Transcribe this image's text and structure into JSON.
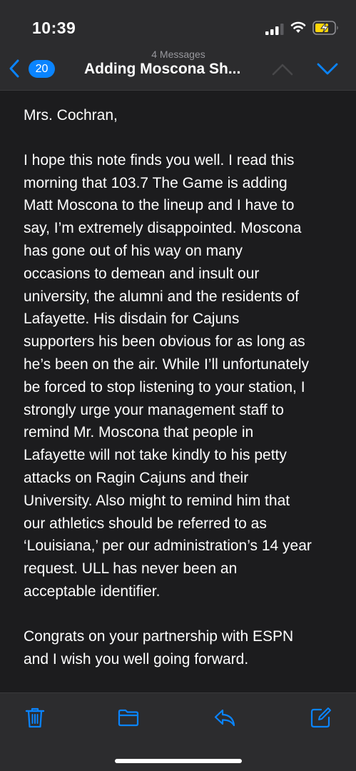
{
  "status_bar": {
    "time": "10:39",
    "icons": [
      "signal-icon",
      "wifi-icon",
      "battery-charging-icon"
    ]
  },
  "nav": {
    "back_count": "20",
    "subtitle": "4 Messages",
    "title": "Adding Moscona Sh...",
    "accent_color": "#0a84ff",
    "icons": [
      "chevron-left-icon",
      "chevron-up-icon",
      "chevron-down-icon"
    ]
  },
  "message": {
    "greeting": "Mrs. Cochran,",
    "paragraph1": "I hope this note finds you well. I read this\nmorning that 103.7 The Game is adding\nMatt Moscona to the lineup and I have to\nsay, I’m extremely disappointed. Moscona\nhas gone out of his way on many\noccasions to demean and insult our\nuniversity, the alumni and the residents of\nLafayette. His disdain for Cajuns\nsupporters his been obvious for as long as\nhe’s been on the air. While I’ll unfortunately\nbe forced to stop listening to your station, I\nstrongly urge your management staff to\nremind Mr. Moscona that people in\nLafayette will not take kindly to his petty\nattacks on Ragin Cajuns and their\nUniversity. Also might to remind him that\nour athletics should be referred to as\n‘Louisiana,’ per our administration’s 14 year\nrequest. ULL has never been an\nacceptable identifier.",
    "paragraph2": "Congrats on your partnership with ESPN\nand I wish you well going forward."
  },
  "toolbar": {
    "icons": [
      "trash-icon",
      "folder-icon",
      "reply-icon",
      "compose-icon"
    ]
  }
}
